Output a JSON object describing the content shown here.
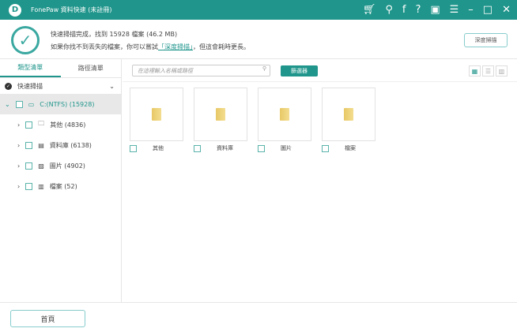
{
  "app": {
    "title": "FonePaw 資料快速 (未註冊)",
    "logo": "D"
  },
  "titlebar_icons": [
    "cart-icon",
    "key-icon",
    "facebook-icon",
    "help-icon",
    "save-icon",
    "menu-icon",
    "minimize-icon",
    "maximize-icon",
    "close-icon"
  ],
  "header": {
    "line1": "快速掃描完成，找到 15928 檔案 (46.2 MB)",
    "line2_pre": "如果你找不到丟失的檔案，你可以嘗試",
    "line2_link": "「深度掃描」",
    "line2_post": "，但這會耗時更長。",
    "deep_scan": "深度掃描"
  },
  "sidebar": {
    "tabs": [
      "類型清單",
      "路徑清單"
    ],
    "scan_mode": "快速掃描",
    "drive": "C:(NTFS) (15928)",
    "items": [
      {
        "label": "其他 (4836)",
        "icon": "folder-icon"
      },
      {
        "label": "資料庫 (6138)",
        "icon": "database-icon"
      },
      {
        "label": "圖片 (4902)",
        "icon": "image-icon"
      },
      {
        "label": "檔案 (52)",
        "icon": "document-icon"
      }
    ]
  },
  "main": {
    "search_placeholder": "在這裡輸入名稱或路徑",
    "filter": "篩選器",
    "tiles": [
      "其他",
      "資料庫",
      "圖片",
      "檔案"
    ]
  },
  "footer": {
    "home": "首頁"
  },
  "colors": {
    "accent": "#1f958b"
  }
}
